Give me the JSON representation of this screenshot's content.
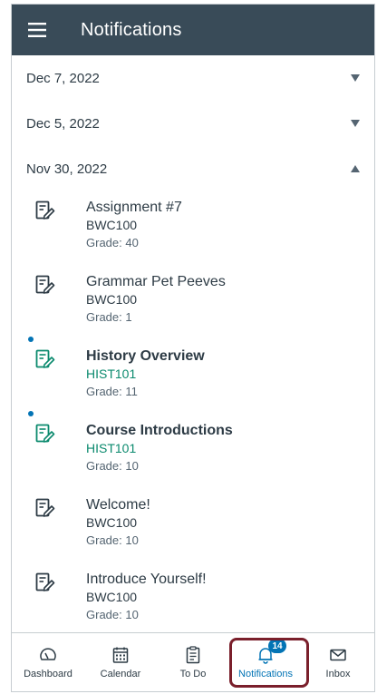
{
  "header": {
    "title": "Notifications"
  },
  "date_groups": [
    {
      "label": "Dec 7, 2022",
      "expanded": false
    },
    {
      "label": "Dec 5, 2022",
      "expanded": false
    },
    {
      "label": "Nov 30, 2022",
      "expanded": true
    }
  ],
  "items": [
    {
      "title": "Assignment #7",
      "course": "BWC100",
      "grade": "Grade: 40",
      "unread": false
    },
    {
      "title": "Grammar Pet Peeves",
      "course": "BWC100",
      "grade": "Grade: 1",
      "unread": false
    },
    {
      "title": "History Overview",
      "course": "HIST101",
      "grade": "Grade: 11",
      "unread": true
    },
    {
      "title": "Course Introductions",
      "course": "HIST101",
      "grade": "Grade: 10",
      "unread": true
    },
    {
      "title": "Welcome!",
      "course": "BWC100",
      "grade": "Grade: 10",
      "unread": false
    },
    {
      "title": "Introduce Yourself!",
      "course": "BWC100",
      "grade": "Grade: 10",
      "unread": false
    }
  ],
  "tabbar": {
    "tabs": [
      {
        "label": "Dashboard",
        "icon": "dashboard-icon"
      },
      {
        "label": "Calendar",
        "icon": "calendar-icon"
      },
      {
        "label": "To Do",
        "icon": "todo-icon"
      },
      {
        "label": "Notifications",
        "icon": "bell-icon",
        "active": true,
        "badge": "14"
      },
      {
        "label": "Inbox",
        "icon": "inbox-icon"
      }
    ]
  },
  "colors": {
    "header_bg": "#394b58",
    "accent_blue": "#0374b5",
    "unread_course": "#0b8a6e",
    "highlight_border": "#7a1f2b"
  }
}
